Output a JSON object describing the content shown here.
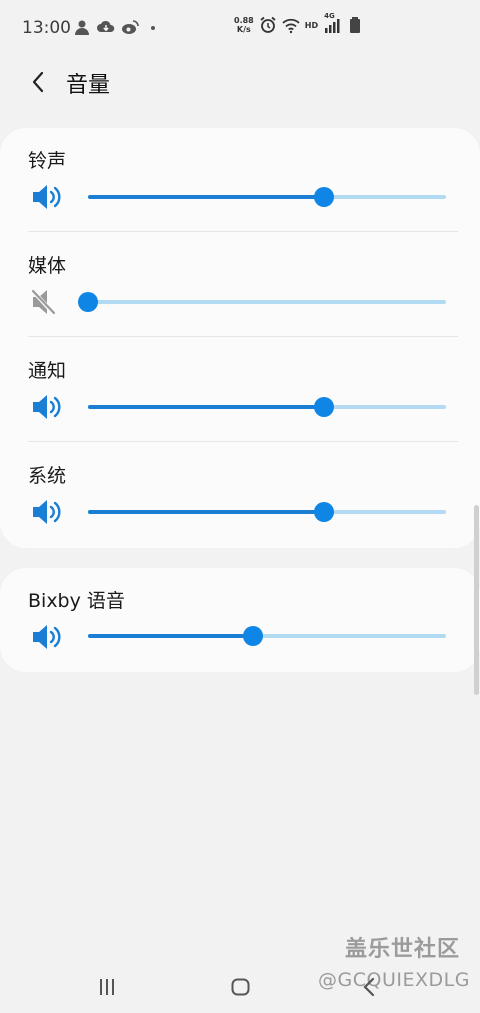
{
  "status_bar": {
    "time": "13:00",
    "net_speed_value": "0.88",
    "net_speed_unit": "K/s",
    "hd_label": "HD",
    "signal_label": "4G"
  },
  "header": {
    "title": "音量",
    "back_icon": "chevron-left-icon"
  },
  "volume_rows": [
    {
      "label": "铃声",
      "icon": "speaker-icon",
      "muted": false,
      "level": 0.66
    },
    {
      "label": "媒体",
      "icon": "speaker-muted-icon",
      "muted": true,
      "level": 0.0
    },
    {
      "label": "通知",
      "icon": "speaker-icon",
      "muted": false,
      "level": 0.66
    },
    {
      "label": "系统",
      "icon": "speaker-icon",
      "muted": false,
      "level": 0.66
    }
  ],
  "bixby_row": {
    "label": "Bixby 语音",
    "icon": "speaker-icon",
    "muted": false,
    "level": 0.46
  },
  "watermark": {
    "title": "盖乐世社区",
    "subtitle": "@GCQUIEXDLG"
  },
  "colors": {
    "accent": "#0f86e6",
    "track_active": "#1a7fd4",
    "track_inactive": "#b3daf3",
    "muted_icon": "#9a9a9a"
  }
}
